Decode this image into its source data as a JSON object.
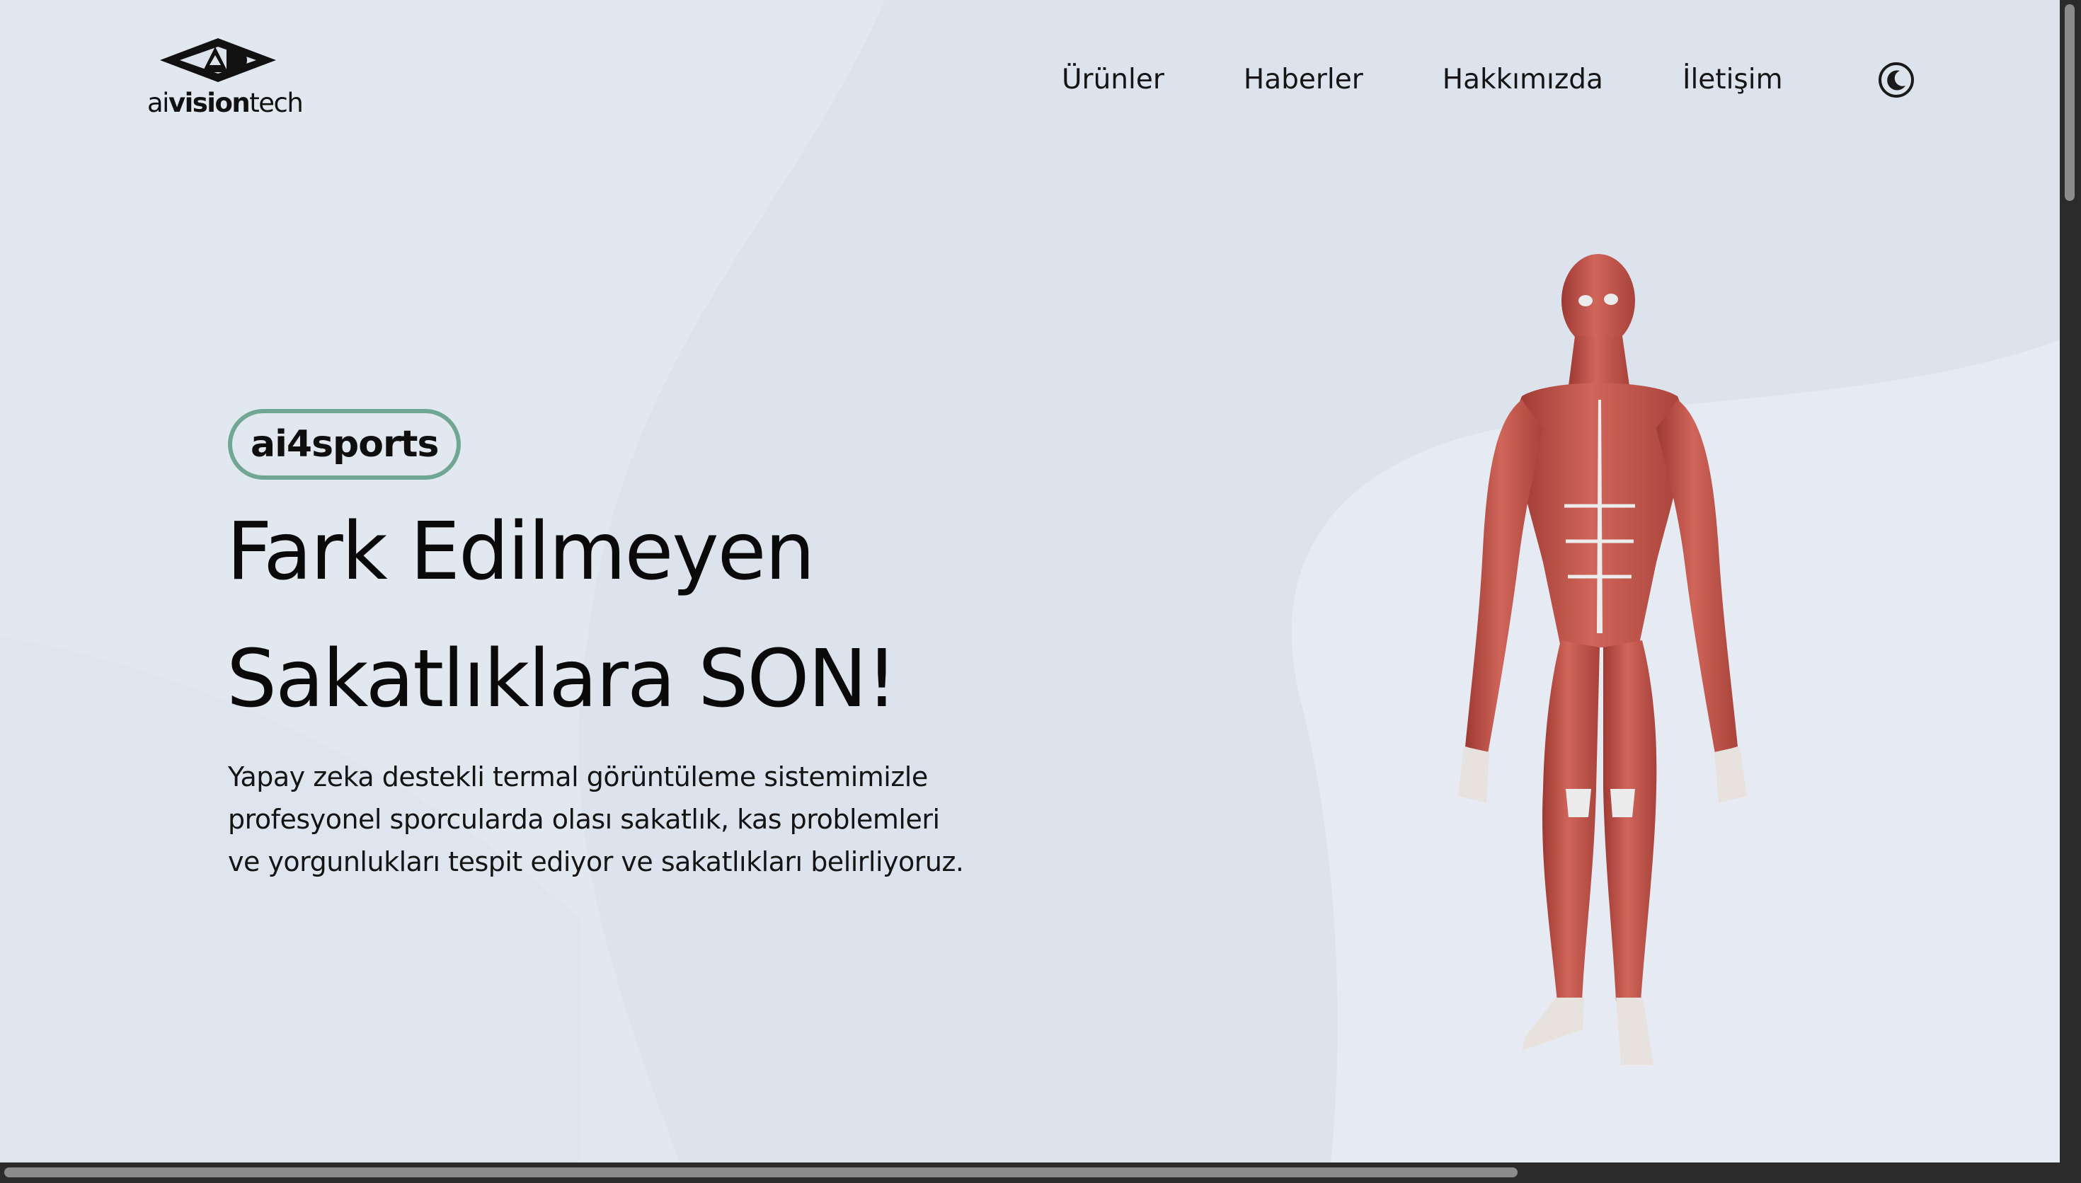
{
  "brand": {
    "logo_name_light": "ai",
    "logo_name_bold": "vision",
    "logo_name_tail": "tech",
    "logo_icon": "ai-monogram-icon"
  },
  "nav": {
    "items": [
      {
        "label": "Ürünler"
      },
      {
        "label": "Haberler"
      },
      {
        "label": "Hakkımızda"
      },
      {
        "label": "İletişim"
      }
    ],
    "theme_toggle_icon": "moon-icon"
  },
  "hero": {
    "badge": "ai4sports",
    "title_line1": "Fark Edilmeyen",
    "title_line2": "Sakatlıklara SON!",
    "description_line1": "Yapay zeka destekli termal görüntüleme sistemimizle",
    "description_line2": "profesyonel sporcularda olası sakatlık, kas problemleri",
    "description_line3": "ve yorgunlukları tespit ediyor ve sakatlıkları belirliyoruz.",
    "image_icon": "muscle-anatomy-figure"
  },
  "colors": {
    "background": "#dde3ec",
    "background_light": "#e3e9f1",
    "badge_border": "#6fa694",
    "text": "#0a0a0a",
    "muscle": "#c4524a",
    "tendon": "#ececec"
  }
}
